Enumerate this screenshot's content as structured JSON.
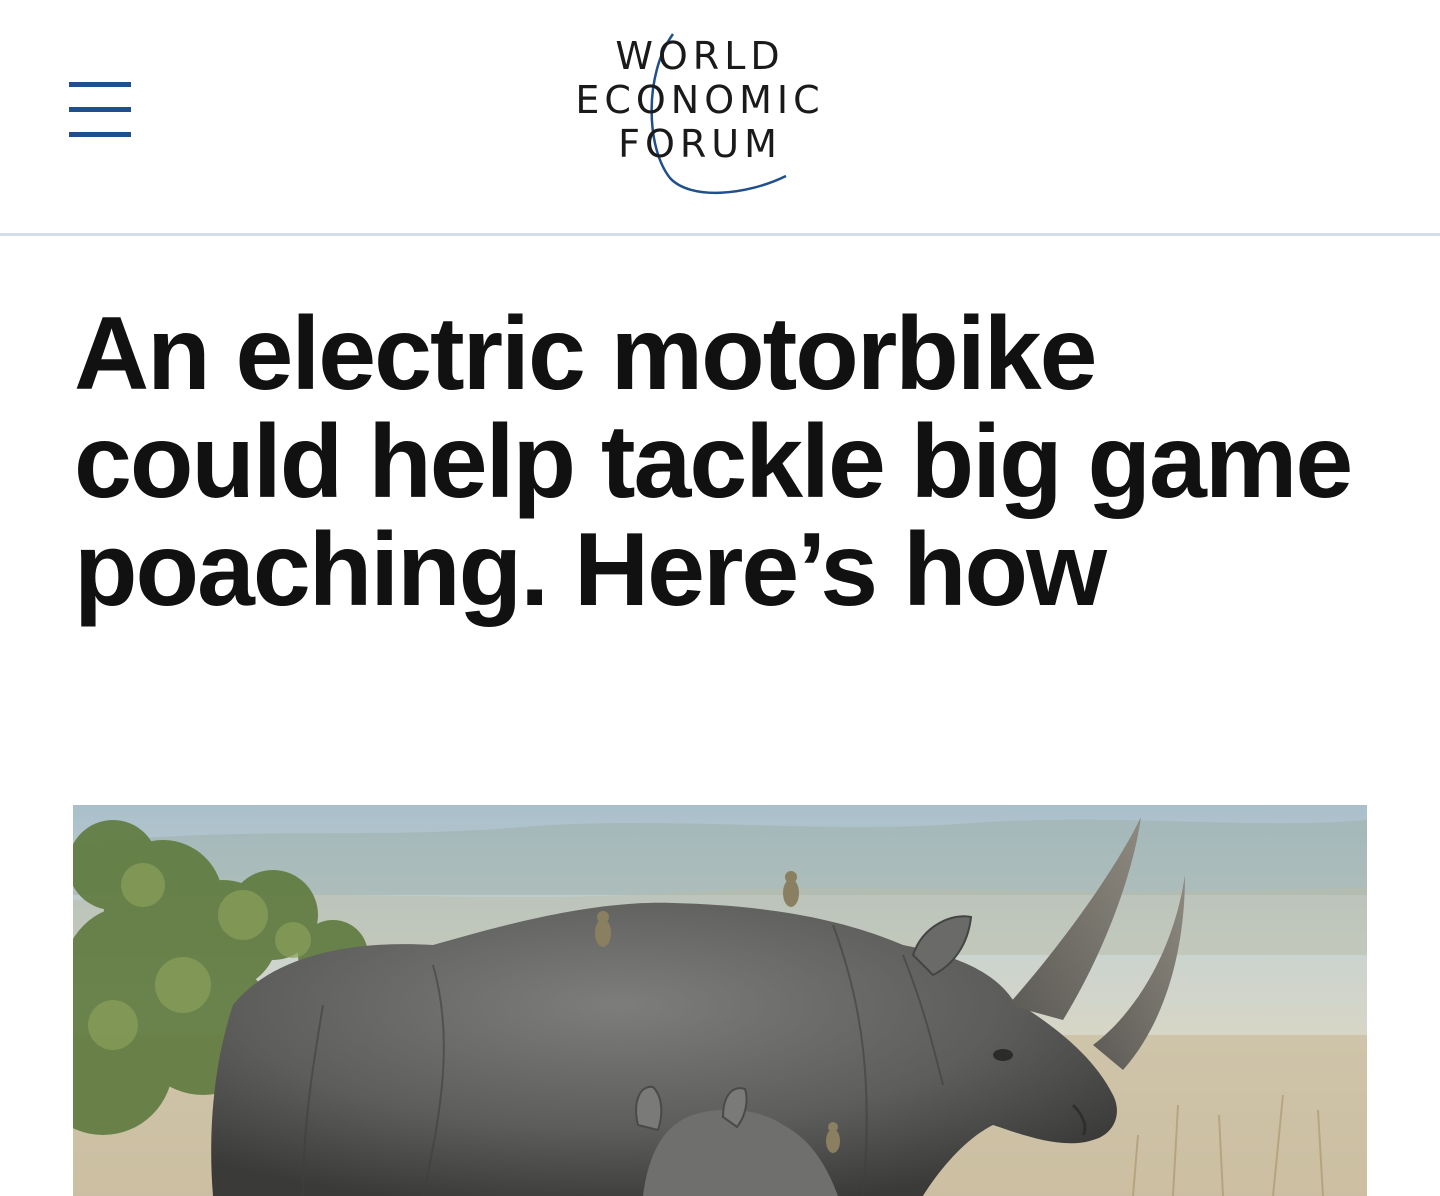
{
  "header": {
    "logo": {
      "line1": "WORLD",
      "line2": "ECONOMIC",
      "line3": "FORUM"
    },
    "menu_icon": "hamburger-menu-icon"
  },
  "article": {
    "headline": "An electric motorbike could help tackle big game poaching. Here’s how"
  },
  "colors": {
    "brand_blue": "#1f4f8c",
    "divider": "#d3deea",
    "headline": "#111111"
  }
}
